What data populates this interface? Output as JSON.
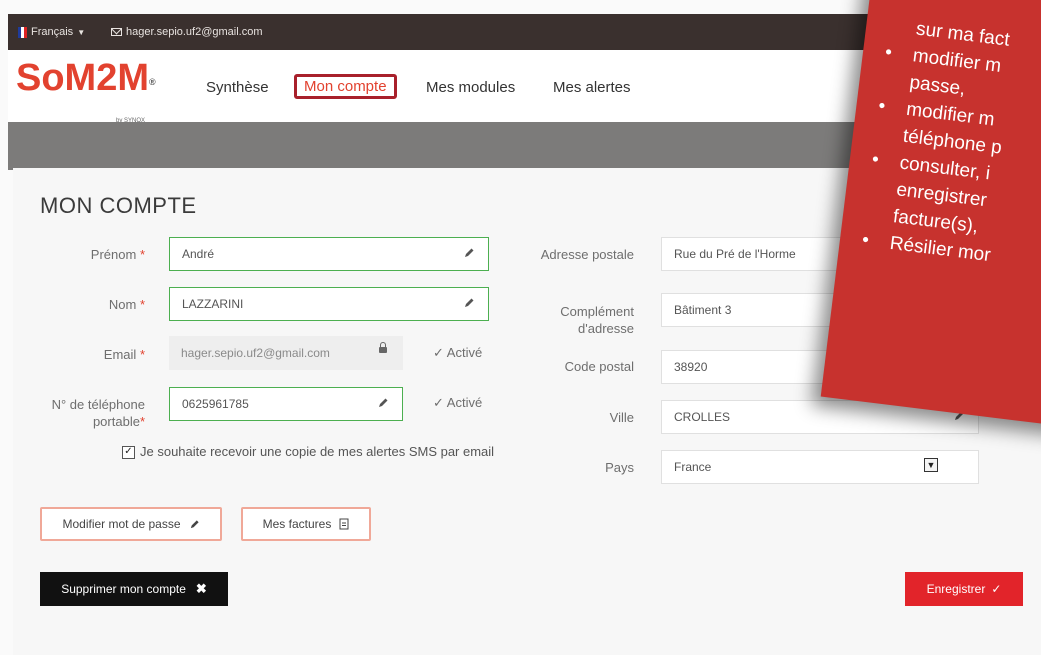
{
  "topbar": {
    "language": "Français",
    "email": "hager.sepio.uf2@gmail.com"
  },
  "logo": {
    "text": "SoM2M",
    "by": "by SYNOX"
  },
  "nav": {
    "items": [
      {
        "label": "Synthèse"
      },
      {
        "label": "Mon compte"
      },
      {
        "label": "Mes modules"
      },
      {
        "label": "Mes alertes"
      }
    ]
  },
  "page": {
    "title": "MON COMPTE"
  },
  "form": {
    "prenom_label": "Prénom",
    "prenom_value": "André",
    "nom_label": "Nom",
    "nom_value": "LAZZARINI",
    "email_label": "Email",
    "email_value": "hager.sepio.uf2@gmail.com",
    "email_status": "✓ Activé",
    "phone_label_1": "N° de téléphone",
    "phone_label_2": "portable",
    "phone_value": "0625961785",
    "phone_status": "✓ Activé",
    "sms_copy_label": "Je souhaite recevoir une copie de mes alertes SMS par email",
    "required_mark": "*",
    "adresse_label": "Adresse postale",
    "adresse_value": "Rue du Pré de l'Horme",
    "complement_label_1": "Complément",
    "complement_label_2": "d'adresse",
    "complement_value": "Bâtiment 3",
    "cp_label": "Code postal",
    "cp_value": "38920",
    "ville_label": "Ville",
    "ville_value": "CROLLES",
    "pays_label": "Pays",
    "pays_value": "France"
  },
  "buttons": {
    "change_password": "Modifier mot de passe",
    "invoices": "Mes factures",
    "delete_account": "Supprimer mon compte",
    "save": "Enregistrer"
  },
  "overlay": {
    "lines": [
      {
        "type": "cont",
        "text": "sur ma fact"
      },
      {
        "type": "bullet",
        "text": "modifier m"
      },
      {
        "type": "cont",
        "text": "passe,"
      },
      {
        "type": "bullet",
        "text": "modifier m"
      },
      {
        "type": "cont",
        "text": "téléphone p"
      },
      {
        "type": "bullet",
        "text": "consulter, i"
      },
      {
        "type": "cont",
        "text": "enregistrer"
      },
      {
        "type": "cont",
        "text": "facture(s),"
      },
      {
        "type": "bullet",
        "text": "Résilier mor"
      }
    ]
  },
  "colors": {
    "accent": "#e2422f",
    "save": "#e2242a",
    "topbar": "#3a302e",
    "band": "#7c7b7a"
  }
}
